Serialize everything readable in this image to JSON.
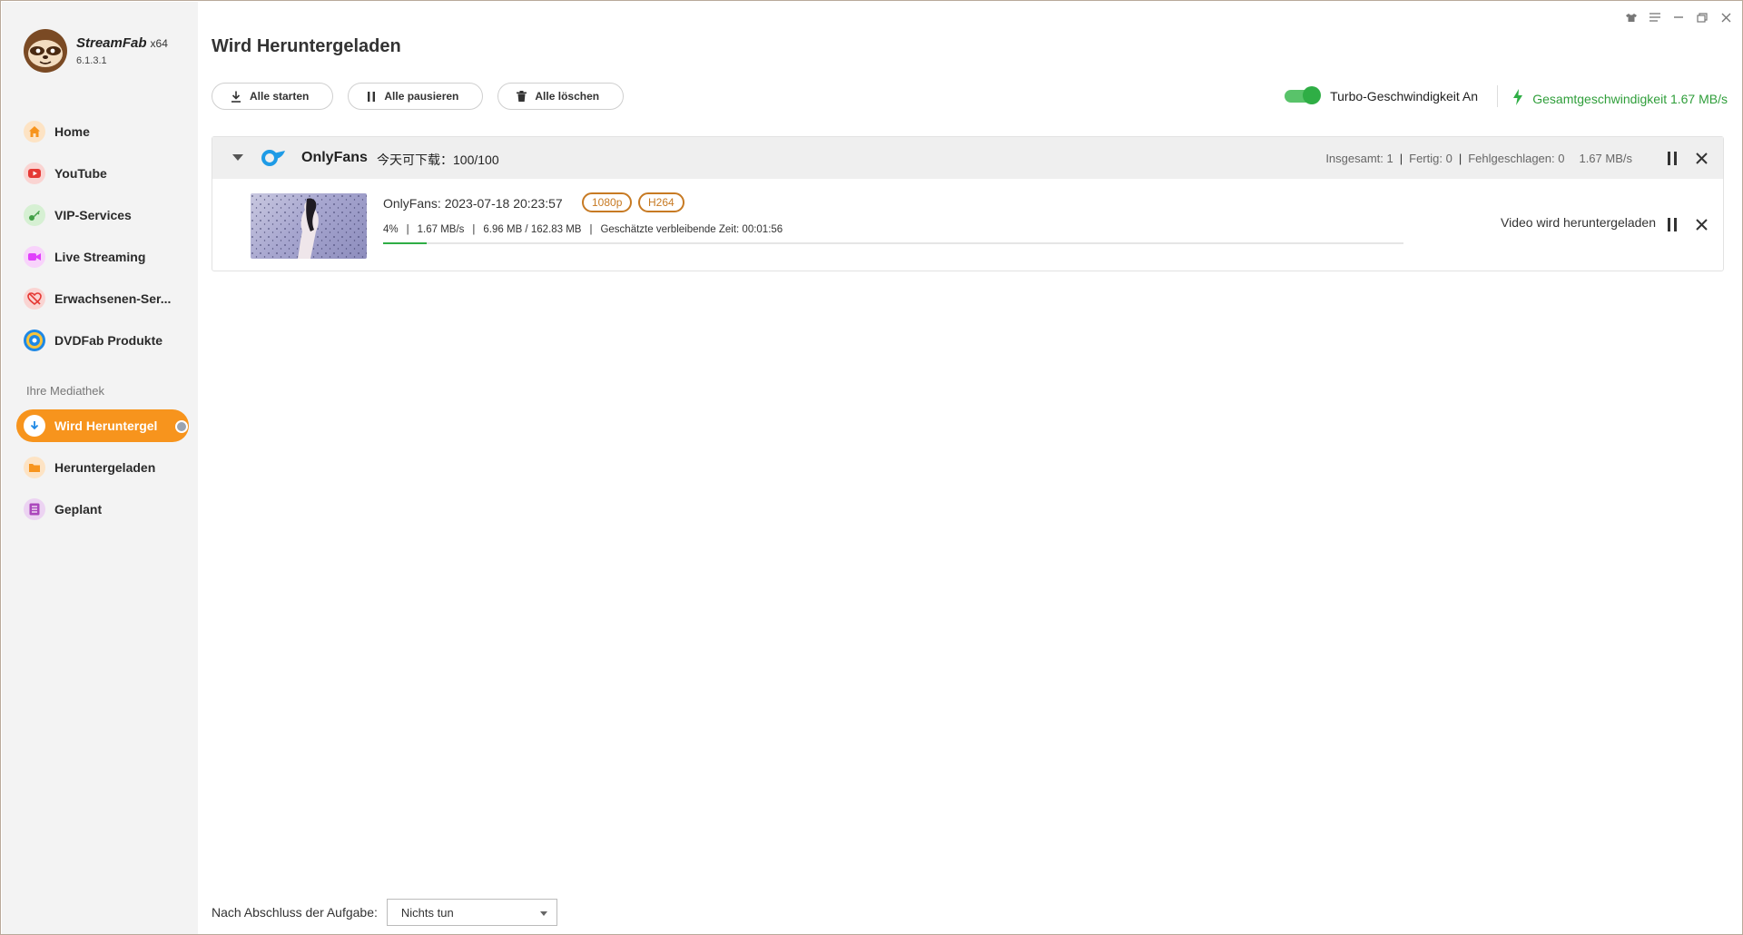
{
  "app": {
    "name": "StreamFab",
    "arch": "x64",
    "version": "6.1.3.1"
  },
  "sidebar": {
    "items": [
      {
        "label": "Home",
        "icon": "home-icon",
        "color": "#f7941d"
      },
      {
        "label": "YouTube",
        "icon": "youtube-icon",
        "color": "#e53935"
      },
      {
        "label": "VIP-Services",
        "icon": "key-icon",
        "color": "#43a047"
      },
      {
        "label": "Live Streaming",
        "icon": "camera-icon",
        "color": "#e040fb"
      },
      {
        "label": "Erwachsenen-Ser...",
        "icon": "adult-icon",
        "color": "#e53935"
      },
      {
        "label": "DVDFab Produkte",
        "icon": "dvdfab-icon",
        "color": "#1e88e5"
      }
    ],
    "library_label": "Ihre Mediathek",
    "library": [
      {
        "label": "Wird Heruntergel",
        "icon": "download-icon",
        "active": true
      },
      {
        "label": "Heruntergeladen",
        "icon": "folder-icon",
        "color": "#f7941d"
      },
      {
        "label": "Geplant",
        "icon": "list-icon",
        "color": "#ab47bc"
      }
    ]
  },
  "main": {
    "title": "Wird Heruntergeladen",
    "toolbar": {
      "start_all": "Alle starten",
      "pause_all": "Alle pausieren",
      "delete_all": "Alle löschen"
    },
    "turbo_label": "Turbo-Geschwindigkeit An",
    "turbo_on": true,
    "total_speed": "Gesamtgeschwindigkeit 1.67 MB/s"
  },
  "group": {
    "service": "OnlyFans",
    "quota": "今天可下载：100/100",
    "total": "Insgesamt: 1",
    "done": "Fertig: 0",
    "failed": "Fehlgeschlagen: 0",
    "speed": "1.67 MB/s",
    "items": [
      {
        "title": "OnlyFans: 2023-07-18 20:23:57",
        "resolution": "1080p",
        "codec": "H264",
        "percent_label": "4%",
        "progress": 0.043,
        "speed": "1.67 MB/s",
        "size": "6.96 MB / 162.83 MB",
        "eta": "Geschätzte verbleibende Zeit: 00:01:56",
        "status": "Video wird heruntergeladen"
      }
    ]
  },
  "footer": {
    "label": "Nach Abschluss der Aufgabe:",
    "select_value": "Nichts tun"
  },
  "colors": {
    "accent": "#f7941d",
    "success": "#2fae45",
    "badge": "#c77a23"
  }
}
